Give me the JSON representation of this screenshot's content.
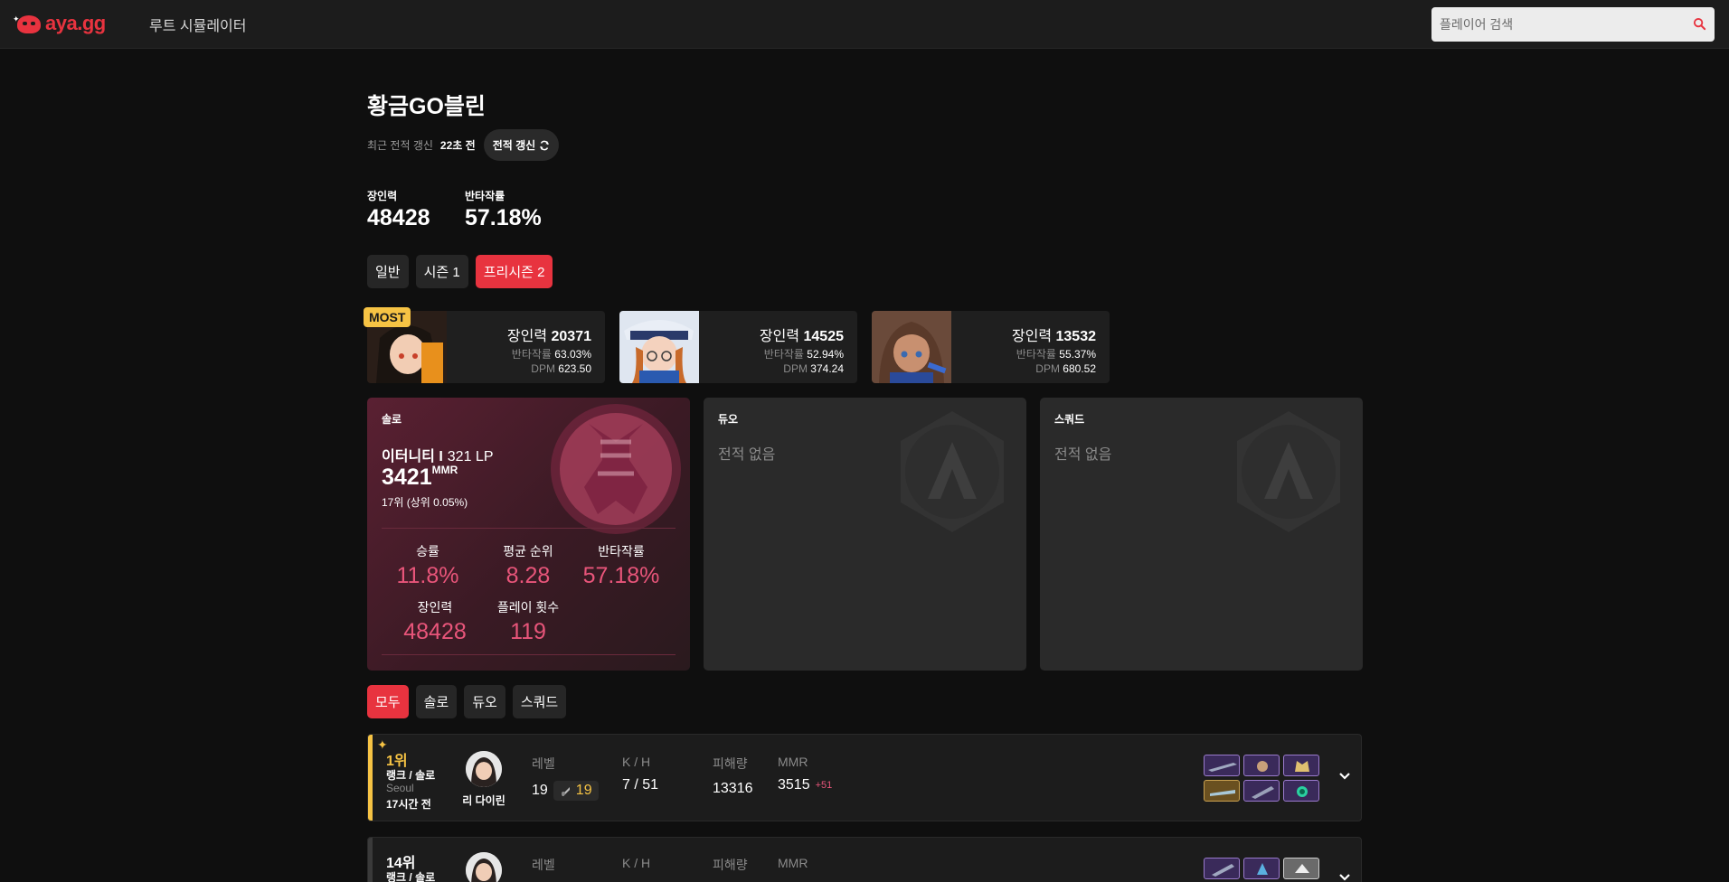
{
  "header": {
    "logo_text": "aya.gg",
    "nav_link": "루트 시뮬레이터",
    "search_placeholder": "플레이어 검색"
  },
  "profile": {
    "name": "황금GO블린",
    "last_update_label": "최근 전적 갱신",
    "last_update_ago": "22초 전",
    "refresh_button": "전적 갱신",
    "stats": [
      {
        "label": "장인력",
        "value": "48428"
      },
      {
        "label": "반타작률",
        "value": "57.18%"
      }
    ]
  },
  "season_tabs": [
    {
      "label": "일반",
      "active": false
    },
    {
      "label": "시즌 1",
      "active": false
    },
    {
      "label": "프리시즌 2",
      "active": true
    }
  ],
  "characters": [
    {
      "most_badge": "MOST",
      "power_label": "장인력",
      "power": "20371",
      "rate_label": "반타작률",
      "rate": "63.03%",
      "dpm_label": "DPM",
      "dpm": "623.50"
    },
    {
      "most_badge": "",
      "power_label": "장인력",
      "power": "14525",
      "rate_label": "반타작률",
      "rate": "52.94%",
      "dpm_label": "DPM",
      "dpm": "374.24"
    },
    {
      "most_badge": "",
      "power_label": "장인력",
      "power": "13532",
      "rate_label": "반타작률",
      "rate": "55.37%",
      "dpm_label": "DPM",
      "dpm": "680.52"
    }
  ],
  "rank_panels": {
    "solo": {
      "title": "솔로",
      "tier": "이터니티 I",
      "lp": "321 LP",
      "mmr": "3421",
      "mmr_unit": "MMR",
      "rank_line": "17위 (상위 0.05%)",
      "stats": [
        {
          "label": "승률",
          "value": "11.8%"
        },
        {
          "label": "평균 순위",
          "value": "8.28"
        },
        {
          "label": "반타작률",
          "value": "57.18%"
        },
        {
          "label": "장인력",
          "value": "48428"
        },
        {
          "label": "플레이 횟수",
          "value": "119"
        }
      ]
    },
    "duo": {
      "title": "듀오",
      "empty_text": "전적 없음"
    },
    "squad": {
      "title": "스쿼드",
      "empty_text": "전적 없음"
    }
  },
  "filter_tabs": [
    {
      "label": "모두",
      "active": true
    },
    {
      "label": "솔로",
      "active": false
    },
    {
      "label": "듀오",
      "active": false
    },
    {
      "label": "스쿼드",
      "active": false
    }
  ],
  "matches": [
    {
      "place": "1위",
      "mode": "랭크 / 솔로",
      "region": "Seoul",
      "time": "17시간 전",
      "character": "리 다이린",
      "level_label": "레벨",
      "level": "19",
      "level_badge": "19",
      "kh_label": "K / H",
      "kh": "7 / 51",
      "damage_label": "피해량",
      "damage": "13316",
      "mmr_label": "MMR",
      "mmr": "3515",
      "mmr_delta": "+51",
      "accent": "#f6c344"
    },
    {
      "place": "14위",
      "mode": "랭크 / 솔로",
      "region": "",
      "time": "",
      "character": "",
      "level_label": "레벨",
      "level": "",
      "level_badge": "",
      "kh_label": "K / H",
      "kh": "",
      "damage_label": "피해량",
      "damage": "",
      "mmr_label": "MMR",
      "mmr": "",
      "mmr_delta": "",
      "accent": "#3a3a3a"
    }
  ],
  "colors": {
    "brand": "#e8333f",
    "gold": "#f6c344",
    "stat_pink": "#e8557a"
  }
}
